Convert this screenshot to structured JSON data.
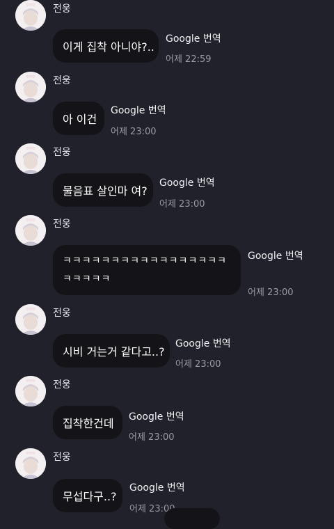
{
  "messages": [
    {
      "sender": "전웅",
      "text": "이게 집착 아니야?..",
      "translate": "Google 번역",
      "time": "어제 22:59"
    },
    {
      "sender": "전웅",
      "text": "아 이건",
      "translate": "Google 번역",
      "time": "어제 23:00"
    },
    {
      "sender": "전웅",
      "text": "물음표 살인마 여?",
      "translate": "Google 번역",
      "time": "어제 23:00"
    },
    {
      "sender": "전웅",
      "text_line1": "ㅋㅋㅋㅋㅋㅋㅋㅋㅋㅋㅋㅋㅋㅋㅋㅋㅋ",
      "text_line2": "ㅋㅋㅋㅋㅋ",
      "translate": "Google 번역",
      "time": "어제 23:00"
    },
    {
      "sender": "전웅",
      "text": "시비 거는거 같다고..?",
      "translate": "Google 번역",
      "time": "어제 23:00"
    },
    {
      "sender": "전웅",
      "text": "집착한건데",
      "translate": "Google 번역",
      "time": "어제 23:00"
    },
    {
      "sender": "전웅",
      "text": "무섭다구..?",
      "translate": "Google 번역",
      "time": "어제 23:00"
    }
  ],
  "colors": {
    "background": "#21212b",
    "bubble": "#141418",
    "time": "#9b9ba6"
  },
  "icons": {
    "avatar": "profile-photo"
  }
}
